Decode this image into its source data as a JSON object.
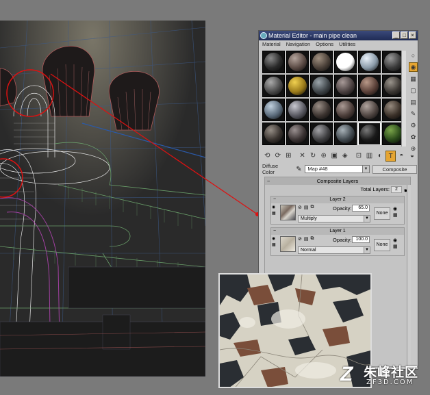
{
  "window": {
    "title": "Material Editor - main pipe clean",
    "controls": [
      "_",
      "□",
      "×"
    ]
  },
  "menu": [
    "Material",
    "Navigation",
    "Options",
    "Utilities"
  ],
  "slots": [
    {
      "color": "#2a2a2a",
      "hl": "#8a8a8a"
    },
    {
      "color": "#5a4a44",
      "hl": "#b4a49c"
    },
    {
      "color": "#4a4038",
      "hl": "#a09080"
    },
    {
      "color": "#ffffff",
      "hl": "#ffffff"
    },
    {
      "color": "#8a9aa8",
      "hl": "#eaf2fa"
    },
    {
      "color": "#3a3a3a",
      "hl": "#999999"
    },
    {
      "color": "#4a4a4a",
      "hl": "#aaaaaa"
    },
    {
      "color": "#9a7a1a",
      "hl": "#f0d050"
    },
    {
      "color": "#3e4448",
      "hl": "#9aa4aa"
    },
    {
      "color": "#4a4040",
      "hl": "#a89a98"
    },
    {
      "color": "#5a4038",
      "hl": "#b89888"
    },
    {
      "color": "#3a3632",
      "hl": "#9a948c"
    },
    {
      "color": "#5a6a7a",
      "hl": "#c0d0de"
    },
    {
      "color": "#585860",
      "hl": "#c8c8d0"
    },
    {
      "color": "#3c3430",
      "hl": "#9a8e86"
    },
    {
      "color": "#4a3c38",
      "hl": "#aa9a94"
    },
    {
      "color": "#4e4440",
      "hl": "#b0a49e"
    },
    {
      "color": "#3a3028",
      "hl": "#968a7e"
    },
    {
      "color": "#3a3430",
      "hl": "#968e86"
    },
    {
      "color": "#3a3232",
      "hl": "#9a9090"
    },
    {
      "color": "#3e3e40",
      "hl": "#a2a2a6"
    },
    {
      "color": "#40484e",
      "hl": "#a8b2b8"
    },
    {
      "color": "#1a1a1a",
      "hl": "#7a7a7a"
    },
    {
      "color": "#2a4a1a",
      "hl": "#7aa44a"
    }
  ],
  "active_slot": 22,
  "side_tools": [
    "○",
    "◉",
    "▦",
    "▢",
    "▤",
    "✎",
    "⚙",
    "✿",
    "⊕"
  ],
  "toolbar": [
    "⟲",
    "⟳",
    "⊞",
    "✕",
    "↻",
    "⊛",
    "▣",
    "◈",
    "⊡",
    "▥",
    "◐",
    "T",
    "◓",
    "◒"
  ],
  "diffuse": {
    "label": "Diffuse Color",
    "map_name": "Map #48",
    "type_button": "Composite"
  },
  "rollout": {
    "title": "Composite Layers",
    "total_label": "Total Layers:",
    "total_value": "2"
  },
  "layers": [
    {
      "title": "Layer 2",
      "opacity_label": "Opacity:",
      "opacity": "65.0",
      "blend": "Multiply",
      "mask": "None"
    },
    {
      "title": "Layer 1",
      "opacity_label": "Opacity:",
      "opacity": "100.0",
      "blend": "Normal",
      "mask": "None"
    }
  ],
  "watermark": {
    "logo": "Z",
    "name": "朱峰社区",
    "url": "ZF3D.COM"
  }
}
